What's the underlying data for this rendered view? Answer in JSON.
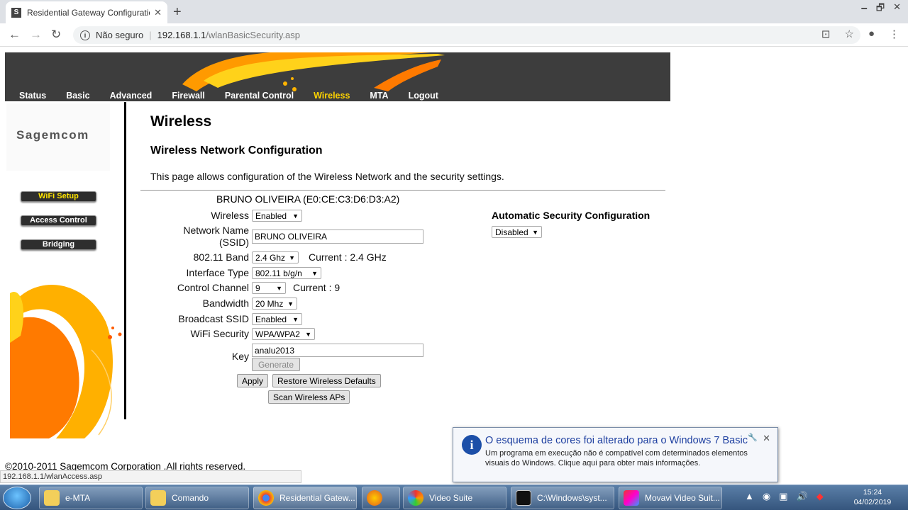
{
  "browser": {
    "tab_title": "Residential Gateway Configuratio",
    "tab_favicon": "S",
    "security_label": "Não seguro",
    "url_host": "192.168.1.1",
    "url_path": "/wlanBasicSecurity.asp"
  },
  "topnav": [
    "Status",
    "Basic",
    "Advanced",
    "Firewall",
    "Parental Control",
    "Wireless",
    "MTA",
    "Logout"
  ],
  "active_nav": "Wireless",
  "brand": "Sagemcom",
  "sidebar": [
    {
      "label": "WiFi Setup",
      "highlight": true
    },
    {
      "label": "Access Control",
      "highlight": false
    },
    {
      "label": "Bridging",
      "highlight": false
    }
  ],
  "page": {
    "title": "Wireless",
    "subtitle": "Wireless Network Configuration",
    "description": "This page allows configuration of the Wireless Network and the security settings.",
    "device": "BRUNO OLIVEIRA (E0:CE:C3:D6:D3:A2)"
  },
  "form": {
    "wireless_label": "Wireless",
    "wireless_value": "Enabled",
    "ssid_label_1": "Network Name",
    "ssid_label_2": "(SSID)",
    "ssid_value": "BRUNO OLIVEIRA",
    "band_label": "802.11 Band",
    "band_value": "2.4 Ghz",
    "band_current": "Current :  2.4 GHz",
    "iftype_label": "Interface Type",
    "iftype_value": "802.11 b/g/n",
    "channel_label": "Control Channel",
    "channel_value": "9",
    "channel_current": "Current : 9",
    "bandwidth_label": "Bandwidth",
    "bandwidth_value": "20 Mhz",
    "broadcast_label": "Broadcast SSID",
    "broadcast_value": "Enabled",
    "security_label": "WiFi Security",
    "security_value": "WPA/WPA2",
    "key_label": "Key",
    "key_value": "analu2013",
    "generate": "Generate",
    "apply": "Apply",
    "restore": "Restore Wireless Defaults",
    "scan": "Scan Wireless APs"
  },
  "auto": {
    "title": "Automatic Security Configuration",
    "value": "Disabled"
  },
  "footer": "©2010-2011 Sagemcom Corporation .All rights reserved.",
  "status_url": "192.168.1.1/wlanAccess.asp",
  "notification": {
    "title": "O esquema de cores foi alterado para o Windows 7 Basic",
    "body": "Um programa em execução não é compatível com determinados elementos visuais do Windows.  Clique aqui para obter mais informações."
  },
  "taskbar": {
    "items": [
      "e-MTA",
      "Comando",
      "Residential Gatew...",
      "",
      "Video Suite",
      "C:\\Windows\\syst...",
      "Movavi Video Suit..."
    ],
    "time": "15:24",
    "date": "04/02/2019"
  },
  "colors": {
    "nav_active": "#ffd400",
    "banner": "#3d3d3d",
    "notif_title": "#1d3fa0"
  }
}
